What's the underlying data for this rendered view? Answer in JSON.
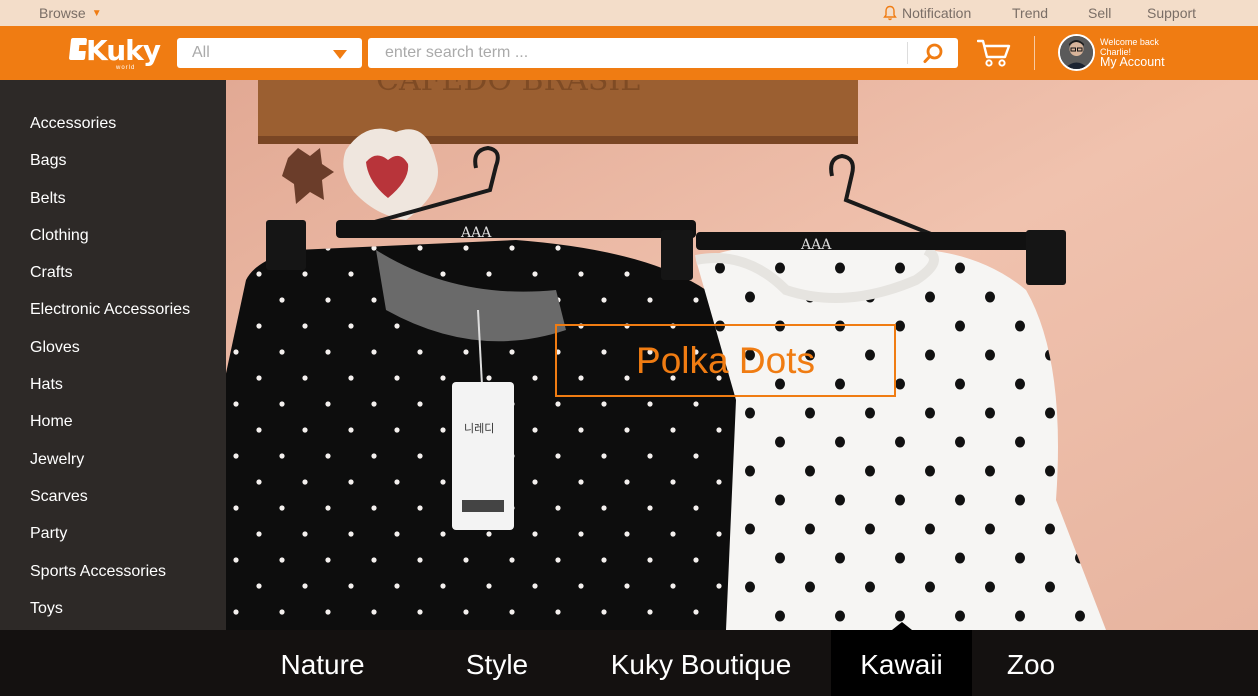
{
  "topbar": {
    "browse_label": "Browse",
    "notification_label": "Notification",
    "trend_label": "Trend",
    "sell_label": "Sell",
    "support_label": "Support"
  },
  "header": {
    "logo_text": "Kuky",
    "logo_subtext": "world",
    "category_select": {
      "selected": "All"
    },
    "search": {
      "placeholder": "enter search term ..."
    },
    "account": {
      "welcome_line1": "Welcome back",
      "welcome_line2": "Charlie!",
      "link_label": "My Account"
    }
  },
  "sidebar": {
    "items": [
      {
        "label": "Accessories"
      },
      {
        "label": "Bags"
      },
      {
        "label": "Belts"
      },
      {
        "label": "Clothing"
      },
      {
        "label": "Crafts"
      },
      {
        "label": "Electronic Accessories"
      },
      {
        "label": "Gloves"
      },
      {
        "label": "Hats"
      },
      {
        "label": "Home"
      },
      {
        "label": "Jewelry"
      },
      {
        "label": "Scarves"
      },
      {
        "label": "Party"
      },
      {
        "label": "Sports Accessories"
      },
      {
        "label": "Toys"
      }
    ]
  },
  "hero": {
    "label": "Polka Dots",
    "sign_text": "CAFEDO BRASIL",
    "hanger_brand": "AAA",
    "tag_text": "니레디"
  },
  "tabs": {
    "items": [
      {
        "label": "Nature"
      },
      {
        "label": "Style"
      },
      {
        "label": "Kuky Boutique"
      },
      {
        "label": "Kawaii"
      },
      {
        "label": "Zoo"
      }
    ],
    "active": "Kawaii"
  },
  "colors": {
    "accent": "#f07c12",
    "topbar_bg": "#f3ddc9",
    "sidebar_bg": "#2d2927",
    "hero_wall": "#e8b8a3"
  },
  "icons": [
    "bell-icon",
    "dropdown-caret-icon",
    "search-icon",
    "shopping-cart-icon",
    "avatar"
  ]
}
